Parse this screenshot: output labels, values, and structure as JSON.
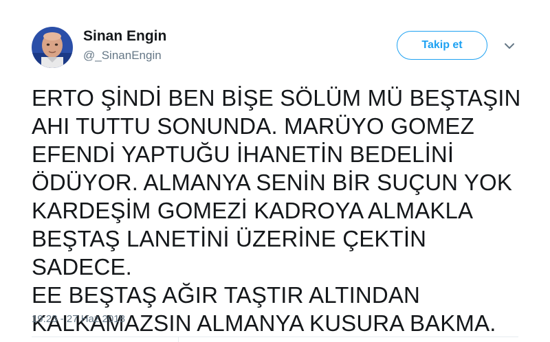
{
  "author": {
    "display_name": "Sinan Engin",
    "handle": "@_SinanEngin"
  },
  "actions": {
    "follow_label": "Takip et",
    "more_icon": "chevron-down-icon"
  },
  "tweet": {
    "text": "ERTO ŞİNDİ BEN BİŞE SÖLÜM MÜ BEŞTAŞIN\nAHI TUTTU SONUNDA. MARÜYO GOMEZ\nEFENDİ YAPTUĞU İHANETİN BEDELİNİ\nÖDÜYOR. ALMANYA SENİN BİR SUÇUN YOK\nKARDEŞİM GOMEZİ KADROYA ALMAKLA\nBEŞTAŞ LANETİNİ ÜZERİNE ÇEKTİN SADECE.\nEE BEŞTAŞ AĞIR TAŞTIR ALTINDAN\nKALKAMAZSIN ALMANYA KUSURA BAKMA.",
    "timestamp": "19:23 - 27 Haz 2018"
  },
  "colors": {
    "accent": "#1da1f2",
    "text_primary": "#14171a",
    "text_secondary": "#657786",
    "divider": "#e6ecf0"
  }
}
